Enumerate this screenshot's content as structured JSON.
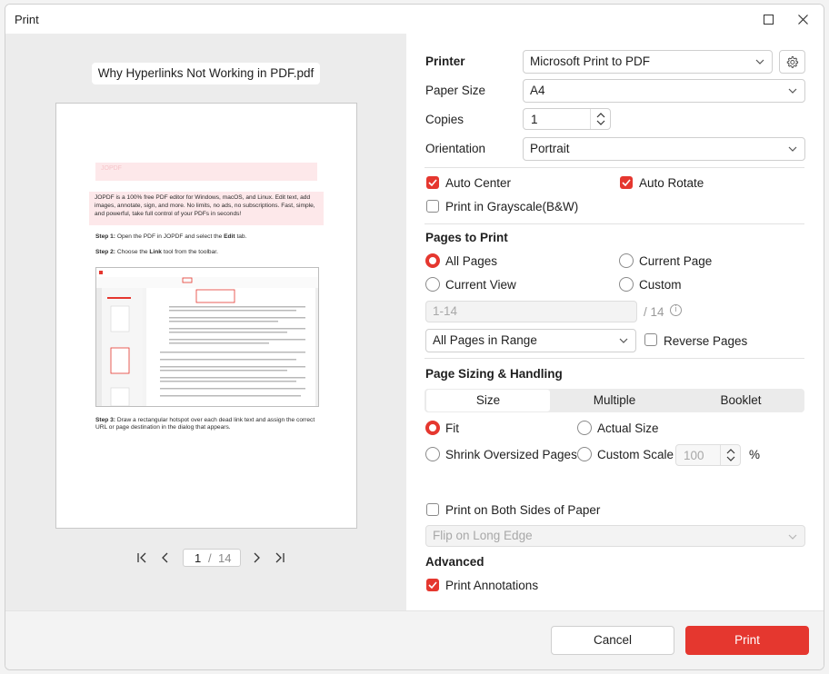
{
  "window": {
    "title": "Print"
  },
  "preview": {
    "file_name": "Why Hyperlinks Not Working in PDF.pdf",
    "page_content": {
      "banner_text": "JOPDF",
      "intro": "JOPDF is a 100% free PDF editor for Windows, macOS, and Linux. Edit text, add images, annotate, sign, and more. No limits, no ads, no subscriptions. Fast, simple, and powerful, take full control of your PDFs in seconds!",
      "step1_label": "Step 1:",
      "step1_text_a": "Open the PDF in JOPDF and select the",
      "step1_bold": "Edit",
      "step1_text_b": "tab.",
      "step2_label": "Step 2:",
      "step2_text_a": "Choose the",
      "step2_bold": "Link",
      "step2_text_b": "tool from the toolbar.",
      "step3_label": "Step 3:",
      "step3_text": "Draw a rectangular hotspot over each dead link text and assign the correct URL or page destination in the dialog that appears."
    },
    "pager": {
      "current": "1",
      "separator": "/",
      "total": "14"
    }
  },
  "settings": {
    "printer": {
      "label": "Printer",
      "value": "Microsoft Print to PDF"
    },
    "paper_size": {
      "label": "Paper Size",
      "value": "A4"
    },
    "copies": {
      "label": "Copies",
      "value": "1"
    },
    "orientation": {
      "label": "Orientation",
      "value": "Portrait"
    },
    "auto_center": {
      "label": "Auto Center",
      "checked": true
    },
    "auto_rotate": {
      "label": "Auto Rotate",
      "checked": true
    },
    "grayscale": {
      "label": "Print in Grayscale(B&W)",
      "checked": false
    },
    "pages_to_print": {
      "title": "Pages to Print",
      "all_pages": "All Pages",
      "current_page": "Current Page",
      "current_view": "Current View",
      "custom": "Custom",
      "selected": "All Pages",
      "range_placeholder": "1-14",
      "range_total": "/ 14",
      "subset": "All Pages in Range",
      "reverse": "Reverse Pages"
    },
    "sizing": {
      "title": "Page Sizing & Handling",
      "tabs": [
        "Size",
        "Multiple",
        "Booklet"
      ],
      "active_tab": "Size",
      "fit": "Fit",
      "actual_size": "Actual Size",
      "shrink": "Shrink Oversized Pages",
      "custom_scale": "Custom Scale",
      "scale_value": "100",
      "scale_unit": "%",
      "selected": "Fit"
    },
    "duplex": {
      "label": "Print on Both Sides of Paper",
      "checked": false,
      "flip": "Flip on Long Edge"
    },
    "advanced": {
      "title": "Advanced",
      "annotations": "Print Annotations",
      "annotations_checked": true
    }
  },
  "footer": {
    "cancel": "Cancel",
    "print": "Print"
  },
  "colors": {
    "accent": "#e5372f"
  }
}
